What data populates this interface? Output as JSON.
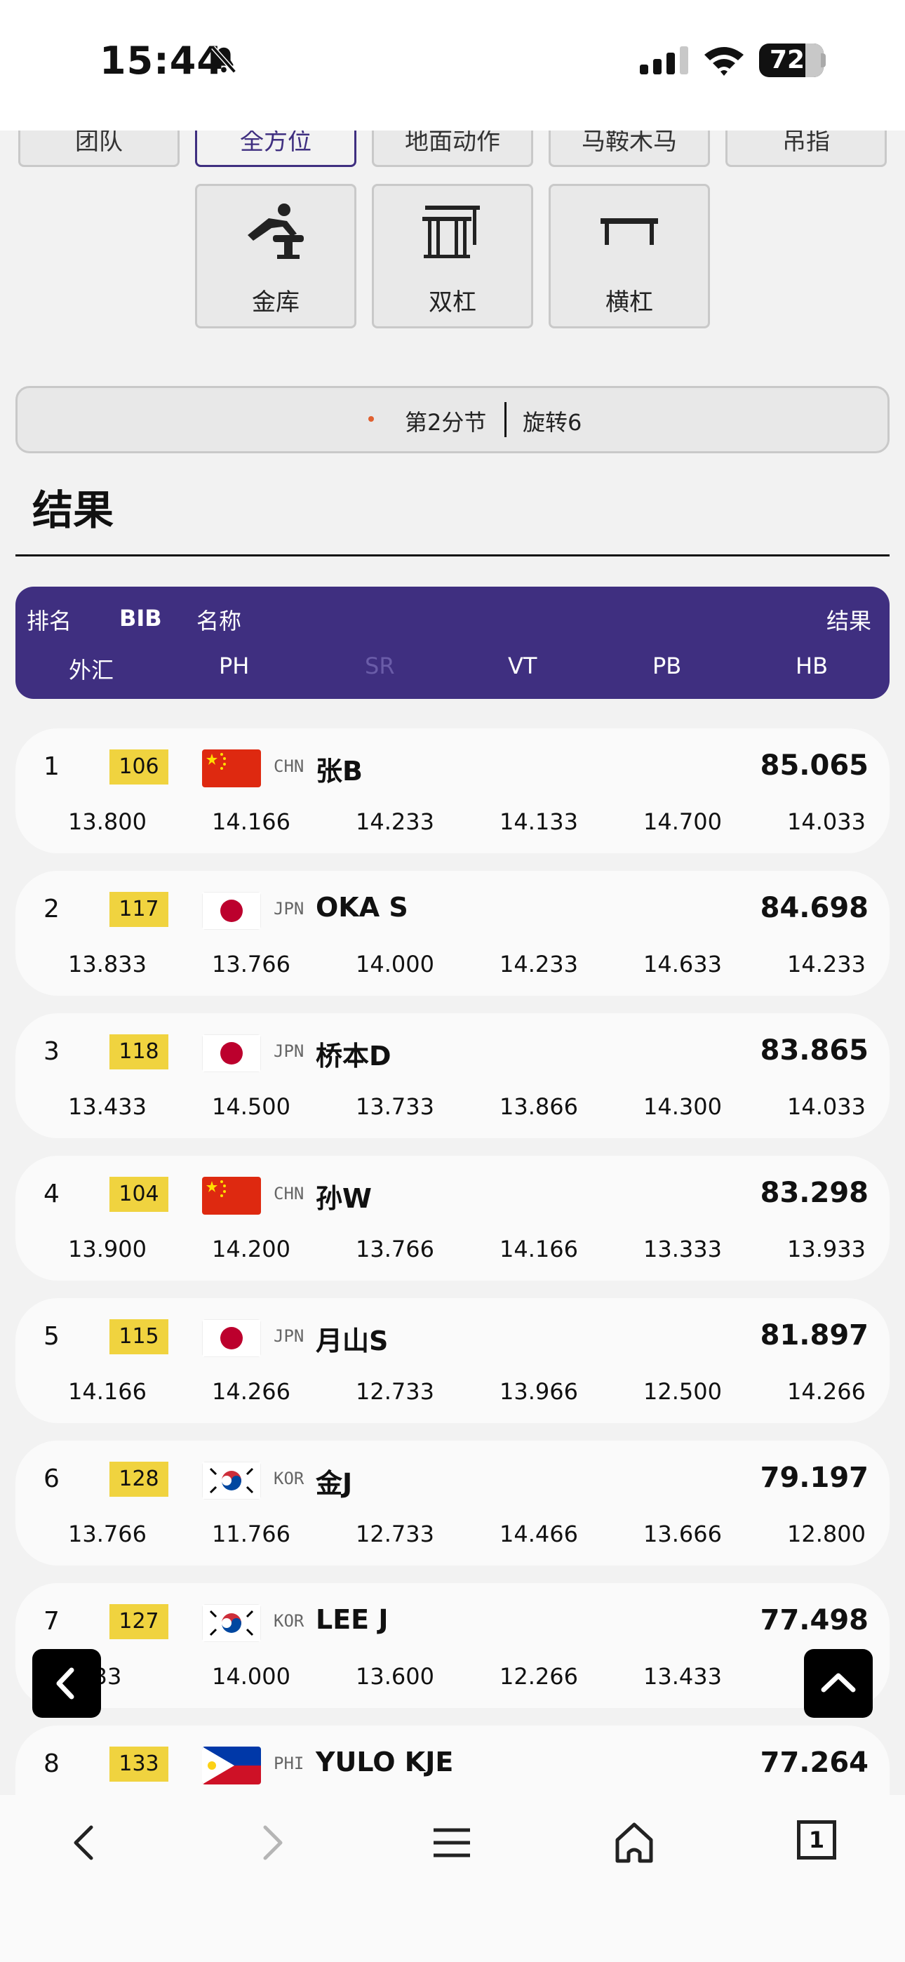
{
  "status_bar": {
    "time": "15:44",
    "battery": "72"
  },
  "events_top": [
    "团队",
    "全方位",
    "地面动作",
    "马鞍木马",
    "吊指"
  ],
  "events_bottom": [
    "金库",
    "双杠",
    "横杠"
  ],
  "session": {
    "part": "第2分节",
    "rotation": "旋转6"
  },
  "results_title": "结果",
  "table_header": {
    "rank": "排名",
    "bib": "BIB",
    "name": "名称",
    "result": "结果",
    "apparatus": [
      "外汇",
      "PH",
      "SR",
      "VT",
      "PB",
      "HB"
    ]
  },
  "rows": [
    {
      "rank": "1",
      "bib": "106",
      "noc": "CHN",
      "name": "张B",
      "total": "85.065",
      "scores": [
        "13.800",
        "14.166",
        "14.233",
        "14.133",
        "14.700",
        "14.033"
      ],
      "flag": "CHN"
    },
    {
      "rank": "2",
      "bib": "117",
      "noc": "JPN",
      "name": "OKA S",
      "total": "84.698",
      "scores": [
        "13.833",
        "13.766",
        "14.000",
        "14.233",
        "14.633",
        "14.233"
      ],
      "flag": "JPN"
    },
    {
      "rank": "3",
      "bib": "118",
      "noc": "JPN",
      "name": "桥本D",
      "total": "83.865",
      "scores": [
        "13.433",
        "14.500",
        "13.733",
        "13.866",
        "14.300",
        "14.033"
      ],
      "flag": "JPN"
    },
    {
      "rank": "4",
      "bib": "104",
      "noc": "CHN",
      "name": "孙W",
      "total": "83.298",
      "scores": [
        "13.900",
        "14.200",
        "13.766",
        "14.166",
        "13.333",
        "13.933"
      ],
      "flag": "CHN"
    },
    {
      "rank": "5",
      "bib": "115",
      "noc": "JPN",
      "name": "月山S",
      "total": "81.897",
      "scores": [
        "14.166",
        "14.266",
        "12.733",
        "13.966",
        "12.500",
        "14.266"
      ],
      "flag": "JPN"
    },
    {
      "rank": "6",
      "bib": "128",
      "noc": "KOR",
      "name": "金J",
      "total": "79.197",
      "scores": [
        "13.766",
        "11.766",
        "12.733",
        "14.466",
        "13.666",
        "12.800"
      ],
      "flag": "KOR"
    },
    {
      "rank": "7",
      "bib": "127",
      "noc": "KOR",
      "name": "LEE J",
      "total": "77.498",
      "scores": [
        "33",
        "14.000",
        "13.600",
        "12.266",
        "13.433",
        "11."
      ],
      "flag": "KOR"
    },
    {
      "rank": "8",
      "bib": "133",
      "noc": "PHI",
      "name": "YULO KJE",
      "total": "77.264",
      "scores": [],
      "flag": "PHI"
    }
  ],
  "toolbar": {
    "tabs_count": "1"
  }
}
